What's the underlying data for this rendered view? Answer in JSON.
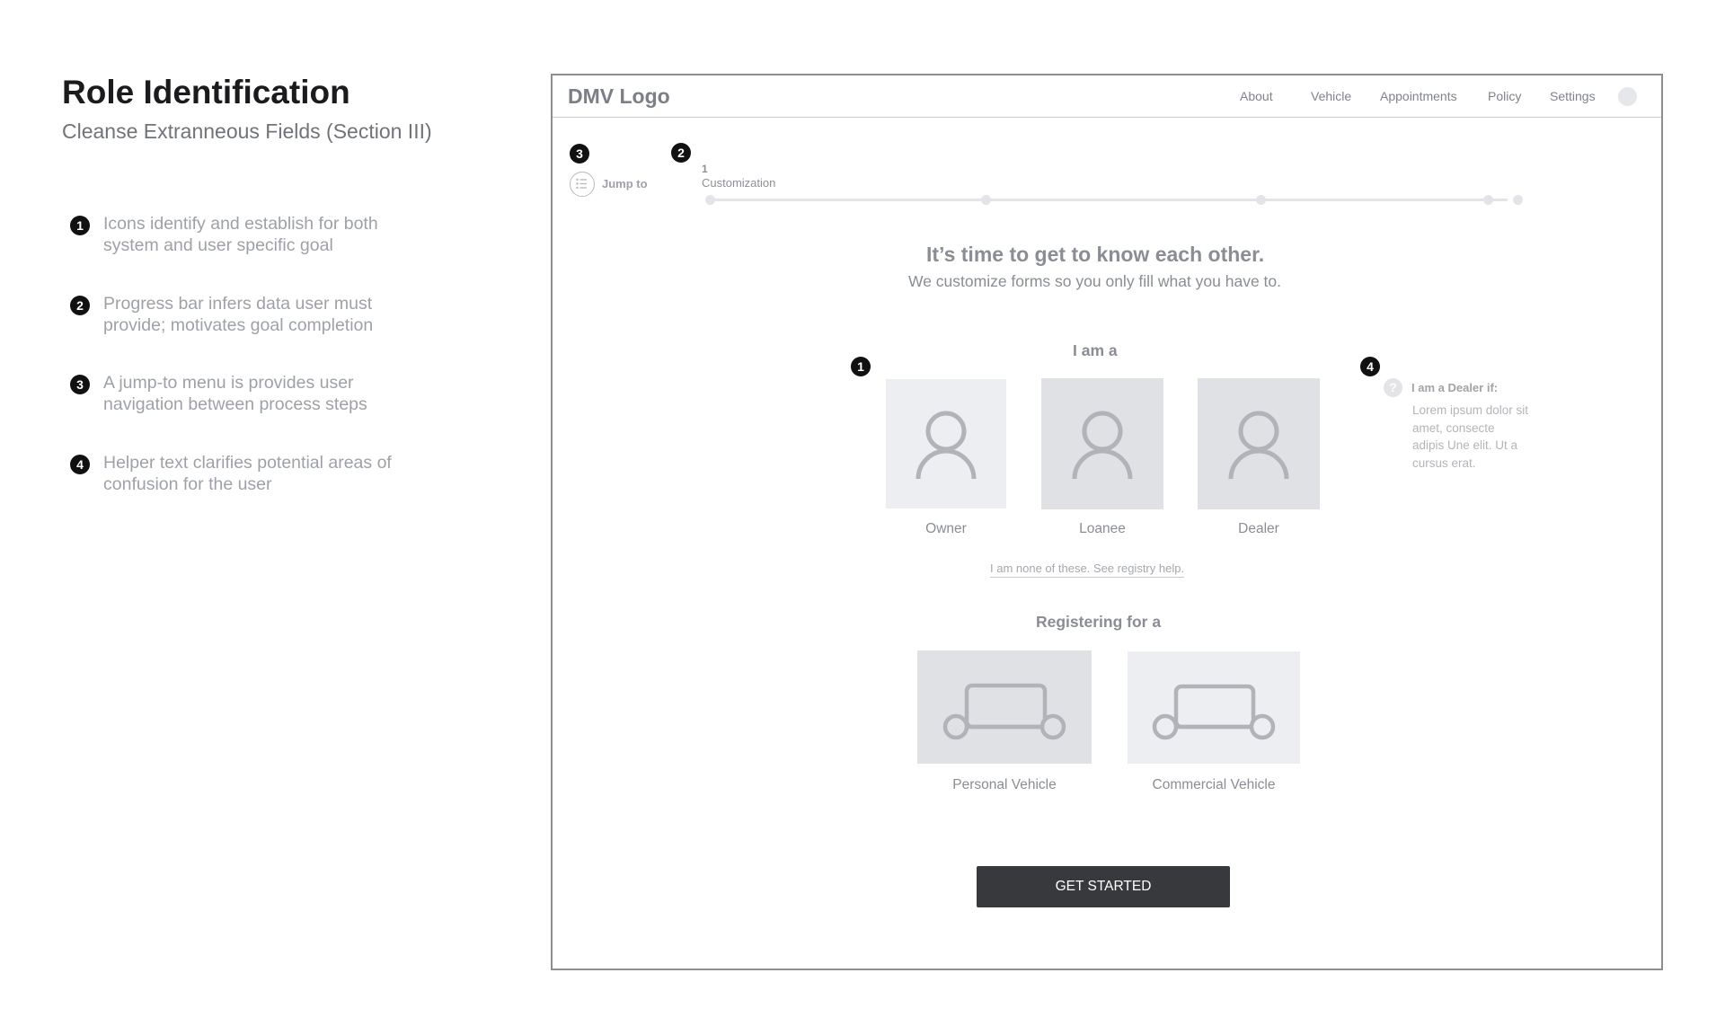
{
  "doc": {
    "title": "Role Identification",
    "subtitle": "Cleanse Extranneous Fields (Section III)",
    "notes": [
      {
        "num": "1",
        "text": "Icons identify and establish for both system and user specific goal"
      },
      {
        "num": "2",
        "text": "Progress bar infers data user must provide; motivates goal completion"
      },
      {
        "num": "3",
        "text": "A jump-to menu is provides user navigation between process steps"
      },
      {
        "num": "4",
        "text": "Helper text clarifies potential areas of confusion for the user"
      }
    ]
  },
  "markers": {
    "m1": "1",
    "m2": "2",
    "m3": "3",
    "m4": "4"
  },
  "app": {
    "logo": "DMV Logo",
    "nav": [
      "About",
      "Vehicle",
      "Appointments",
      "Policy",
      "Settings"
    ],
    "jump_to": "Jump to",
    "progress": {
      "step_number": "1",
      "step_name": "Customization",
      "dots": 5
    },
    "headline": "It’s time to get to know each other.",
    "subline": "We customize forms so you only fill what you have to.",
    "role_prompt": "I am a",
    "roles": [
      {
        "label": "Owner",
        "selected": false
      },
      {
        "label": "Loanee",
        "selected": true
      },
      {
        "label": "Dealer",
        "selected": true
      }
    ],
    "none_link": "I am none of these. See registry help.",
    "registering_prompt": "Registering for a",
    "vehicles": [
      {
        "label": "Personal Vehicle",
        "selected": true
      },
      {
        "label": "Commercial Vehicle",
        "selected": false
      }
    ],
    "helper": {
      "icon": "?",
      "title": "I am a Dealer if:",
      "body": "Lorem ipsum dolor sit amet, consecte adipis Une elit. Ut a cursus erat."
    },
    "cta": "GET STARTED"
  }
}
